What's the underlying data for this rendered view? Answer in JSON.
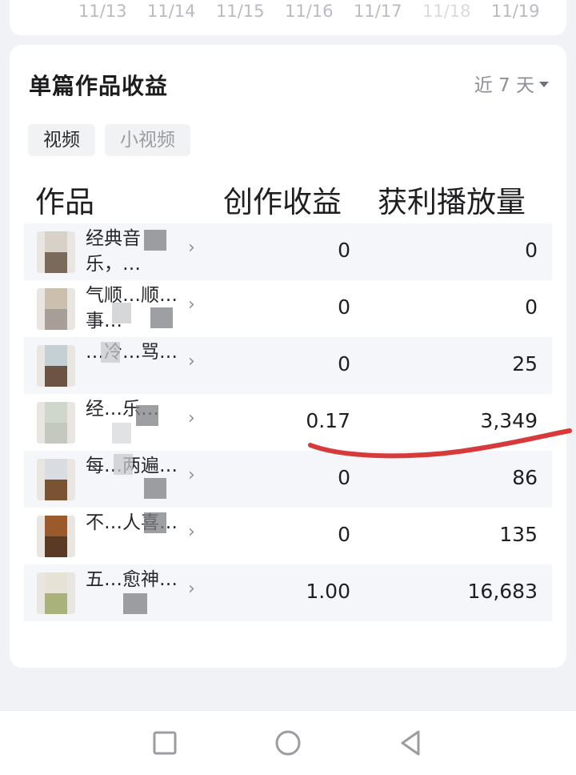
{
  "top_axis": {
    "dates": [
      "11/13",
      "11/14",
      "11/15",
      "11/16",
      "11/17",
      "11/18",
      "11/19"
    ]
  },
  "earnings_card": {
    "title": "单篇作品收益",
    "range_label": "近 7 天",
    "tabs": [
      {
        "label": "视频",
        "active": true
      },
      {
        "label": "小视频",
        "active": false
      }
    ],
    "columns": {
      "work": "作品",
      "earnings": "创作收益",
      "plays": "获利播放量"
    },
    "rows": [
      {
        "title": "经典音乐，…",
        "earnings": "0",
        "plays": "0"
      },
      {
        "title": "气顺…顺…事…",
        "earnings": "0",
        "plays": "0"
      },
      {
        "title": "…冷…骂…",
        "earnings": "0",
        "plays": "25"
      },
      {
        "title": "经…乐…",
        "earnings": "0.17",
        "plays": "3,349"
      },
      {
        "title": "每…两遍…",
        "earnings": "0",
        "plays": "86"
      },
      {
        "title": "不…人喜…",
        "earnings": "0",
        "plays": "135"
      },
      {
        "title": "五…愈神…",
        "earnings": "1.00",
        "plays": "16,683"
      }
    ]
  },
  "colors": {
    "annotation": "#d63a3a",
    "card_bg": "#ffffff",
    "page_bg": "#f1f2f6"
  },
  "nav": {
    "icons": [
      "square-icon",
      "circle-icon",
      "back-triangle-icon"
    ]
  }
}
